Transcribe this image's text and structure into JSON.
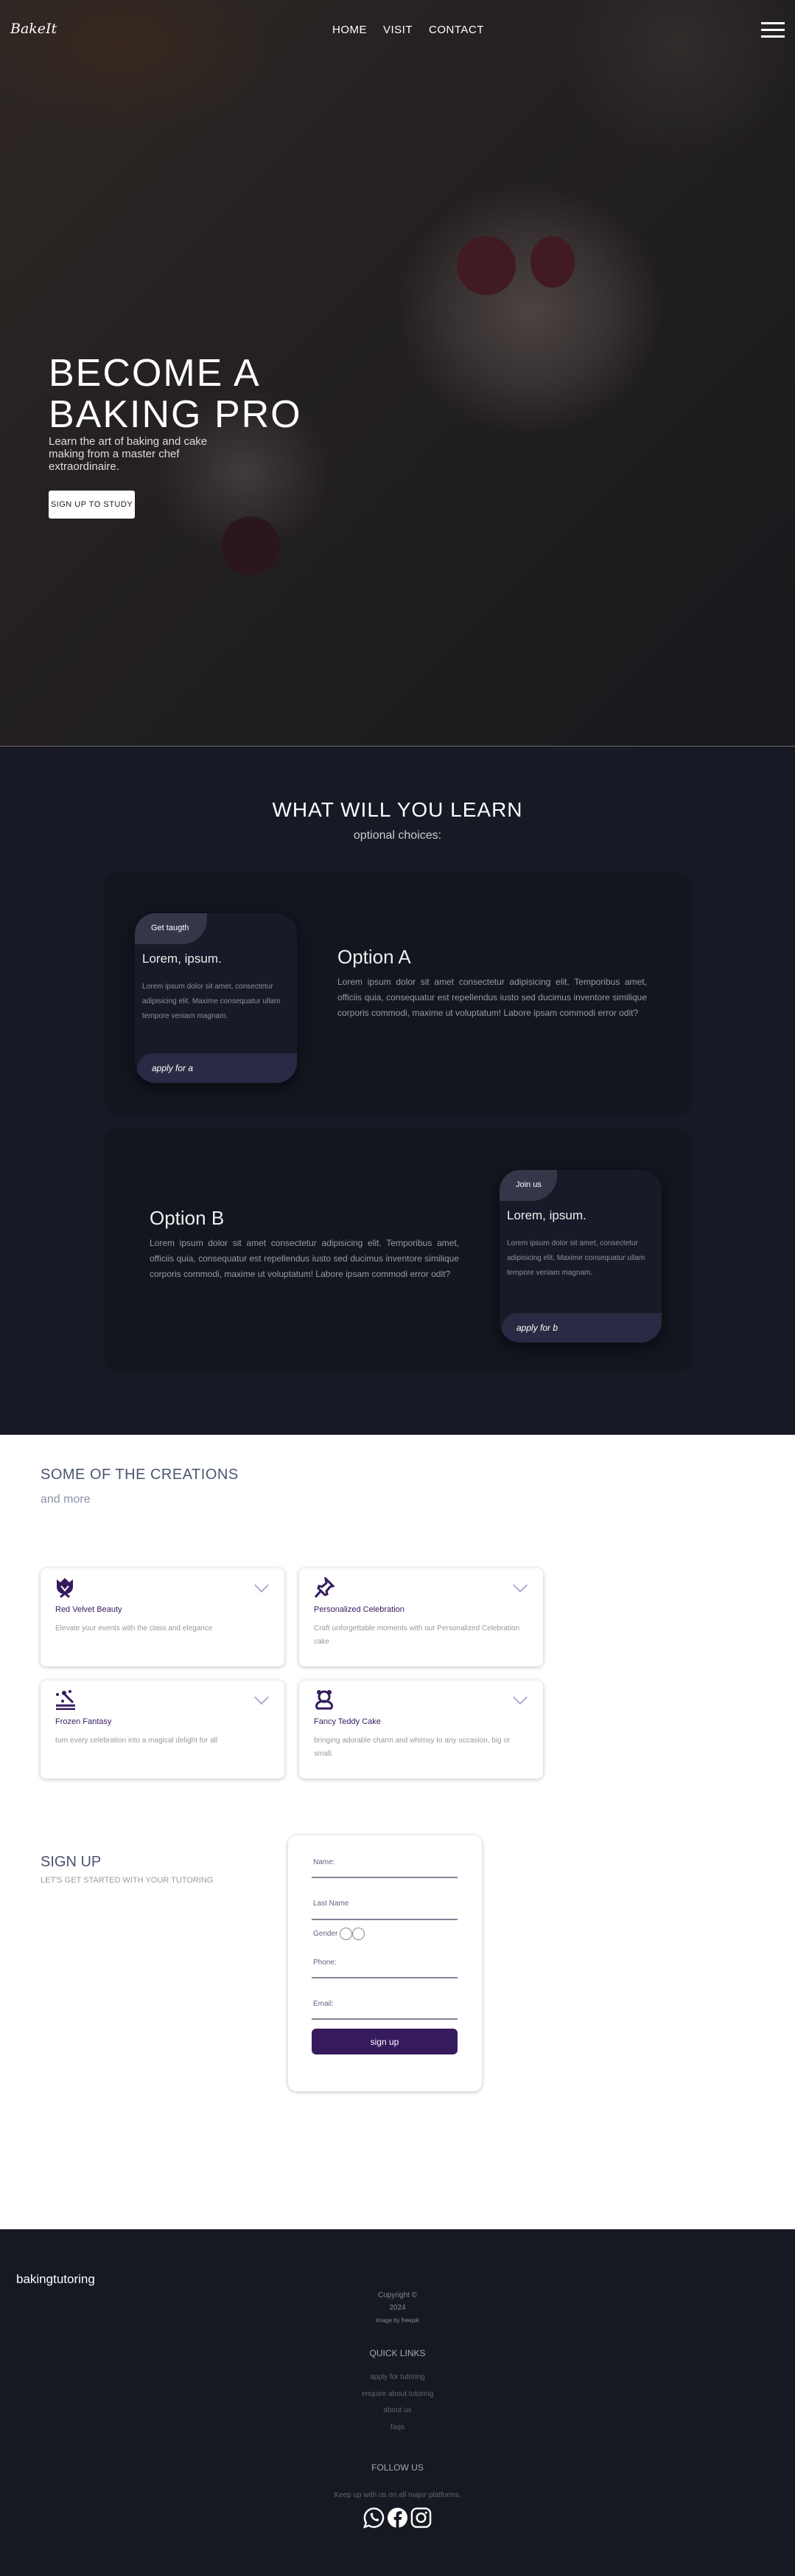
{
  "nav": {
    "logo": "BakeIt",
    "links": [
      "HOME",
      "VISIT",
      "CONTACT"
    ]
  },
  "hero": {
    "title_line1": "BECOME A",
    "title_line2": "BAKING PRO",
    "subtitle": "Learn the art of baking and cake making from a master chef extraordinaire.",
    "button": "SIGN UP TO STUDY"
  },
  "learn": {
    "title": "WHAT WILL YOU LEARN",
    "subtitle": "optional choices:",
    "option_a": {
      "tag": "Get taugth",
      "card_title": "Lorem, ipsum.",
      "card_text": "Lorem ipsum dolor sit amet, consectetur adipisicing elit. Maxime consequatur ullam tempore veniam magnam.",
      "apply": "apply for a",
      "heading": "Option A",
      "text": "Lorem ipsum dolor sit amet consectetur adipisicing elit. Temporibus amet, officiis quia, consequatur est repellendus iusto sed ducimus inventore similique corporis commodi, maxime ut voluptatum! Labore ipsam commodi error odit?"
    },
    "option_b": {
      "tag": "Join us",
      "card_title": "Lorem, ipsum.",
      "card_text": "Lorem ipsum dolor sit amet, consectetur adipisicing elit. Maxime consequatur ullam tempore veniam magnam.",
      "apply": "apply for b",
      "heading": "Option B",
      "text": "Lorem ipsum dolor sit amet consectetur adipisicing elit. Temporibus amet, officiis quia, consequatur est repellendus iusto sed ducimus inventore similique corporis commodi, maxime ut voluptatum! Labore ipsam commodi error odit?"
    }
  },
  "creations": {
    "title": "SOME OF THE CREATIONS",
    "subtitle": "and more",
    "items": [
      {
        "icon": "cake-crown-icon",
        "title": "Red Velvet Beauty",
        "text": "Elevate your events with the class and elegance"
      },
      {
        "icon": "pushpin-icon",
        "title": "Personalized Celebration",
        "text": "Craft unforgettable moments with our Personalized Celebration cake"
      },
      {
        "icon": "magic-wand-icon",
        "title": "Frozen Fantasy",
        "text": "turn every celebration into a magical delight for all"
      },
      {
        "icon": "teddy-bear-icon",
        "title": "Fancy Teddy Cake",
        "text": "bringing adorable charm and whimsy to any occasion, big or small."
      }
    ]
  },
  "signup": {
    "title": "SIGN UP",
    "subtitle": "LET'S GET STARTED WITH YOUR TUTORING",
    "name": "Name:",
    "last_name": "Last Name",
    "gender": "Gender",
    "phone": "Phone:",
    "email": "Email:",
    "button": "sign up"
  },
  "footer": {
    "brand": "bakingtutoring",
    "copyright": "Copyright ©",
    "year": "2024",
    "credit": "image by freepik",
    "quick_links_title": "QUICK LINKS",
    "links": [
      "apply for tutoring",
      "enquire about tutoring",
      "about us",
      "faqs"
    ],
    "follow_title": "FOLLOW US",
    "follow_text": "Keep up with us on all major platforms."
  },
  "colors": {
    "dark_bg": "#171924",
    "accent": "#351b5e",
    "card_tab": "#2a2a44"
  }
}
